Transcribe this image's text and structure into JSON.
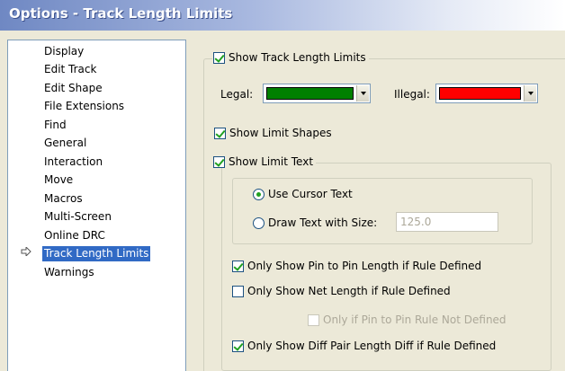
{
  "window": {
    "title": "Options - Track Length Limits"
  },
  "nav": {
    "items": [
      {
        "label": "Display"
      },
      {
        "label": "Edit Track"
      },
      {
        "label": "Edit Shape"
      },
      {
        "label": "File Extensions"
      },
      {
        "label": "Find"
      },
      {
        "label": "General"
      },
      {
        "label": "Interaction"
      },
      {
        "label": "Move"
      },
      {
        "label": "Macros"
      },
      {
        "label": "Multi-Screen"
      },
      {
        "label": "Online DRC"
      },
      {
        "label": "Track Length Limits"
      },
      {
        "label": "Warnings"
      }
    ],
    "selected": "Track Length Limits",
    "selected_marker_icon": "arrow-right-icon"
  },
  "settings": {
    "show_track_length_limits": {
      "label": "Show Track Length Limits",
      "checked": true
    },
    "legal": {
      "label": "Legal:",
      "color": "#008000"
    },
    "illegal": {
      "label": "Illegal:",
      "color": "#ff0000"
    },
    "show_limit_shapes": {
      "label": "Show Limit Shapes",
      "checked": true
    },
    "show_limit_text": {
      "label": "Show Limit Text",
      "checked": true
    },
    "use_cursor_text": {
      "label": "Use Cursor Text",
      "selected": true
    },
    "draw_text_with_size": {
      "label": "Draw Text with Size:",
      "selected": false,
      "value": "125.0"
    },
    "pin_to_pin": {
      "label": "Only Show Pin to Pin Length if Rule Defined",
      "checked": true
    },
    "net_length": {
      "label": "Only Show Net Length if Rule Defined",
      "checked": false
    },
    "pin_rule_not_defined": {
      "label": "Only if Pin to Pin Rule Not Defined",
      "checked": false,
      "enabled": false
    },
    "diff_pair": {
      "label": "Only Show Diff Pair Length Diff if Rule Defined",
      "checked": true
    }
  },
  "colors": {
    "selection": "#316ac5",
    "panel": "#ece9d8",
    "check": "#21a121"
  }
}
